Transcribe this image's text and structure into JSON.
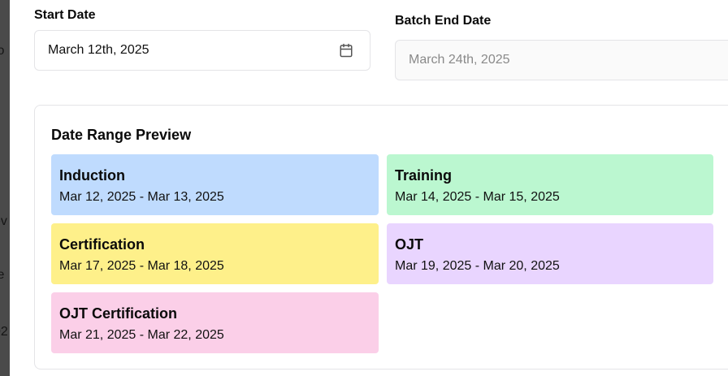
{
  "background_fragments": [
    "to",
    "s",
    "ev",
    "te",
    "02"
  ],
  "start_date": {
    "label": "Start Date",
    "value": "March 12th, 2025",
    "icon": "calendar-icon"
  },
  "batch_end_date": {
    "label": "Batch End Date",
    "value": "March 24th, 2025"
  },
  "preview": {
    "title": "Date Range Preview",
    "phases": [
      {
        "name": "Induction",
        "range": "Mar 12, 2025 - Mar 13, 2025",
        "color": "#bfdbfe"
      },
      {
        "name": "Training",
        "range": "Mar 14, 2025 - Mar 15, 2025",
        "color": "#bbf7d0"
      },
      {
        "name": "Certification",
        "range": "Mar 17, 2025 - Mar 18, 2025",
        "color": "#fef08a"
      },
      {
        "name": "OJT",
        "range": "Mar 19, 2025 - Mar 20, 2025",
        "color": "#e9d5ff"
      },
      {
        "name": "OJT Certification",
        "range": "Mar 21, 2025 - Mar 22, 2025",
        "color": "#fbcfe8"
      }
    ]
  }
}
